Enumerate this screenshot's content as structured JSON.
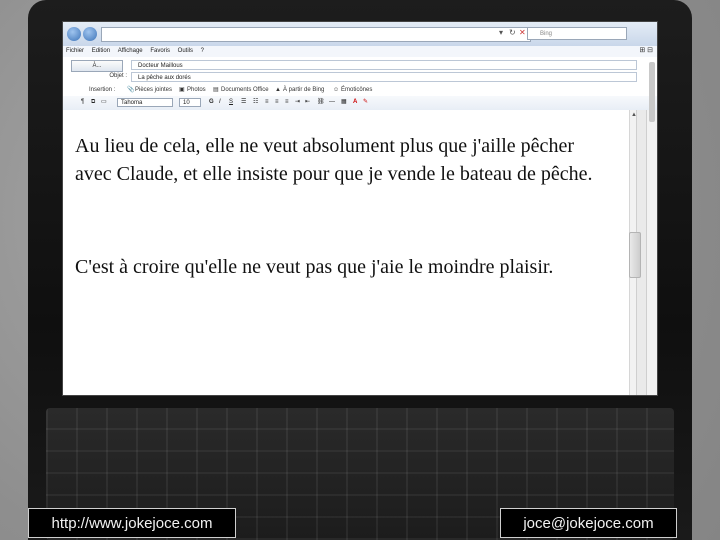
{
  "browser": {
    "search_engine": "Bing"
  },
  "menu": [
    "Fichier",
    "Edition",
    "Affichage",
    "Favoris",
    "Outils",
    "?"
  ],
  "email": {
    "to_button": "À...",
    "to_value": "Docteur Maillous",
    "subject_label": "Objet :",
    "subject_value": "La pêche aux dorés",
    "insert_label": "Insertion :",
    "insert_items": [
      "Pièces jointes",
      "Photos",
      "Documents Office",
      "À partir de Bing",
      "Émoticônes"
    ],
    "font_name": "Tahoma",
    "font_size": "10",
    "format_buttons": [
      "G",
      "I",
      "S"
    ]
  },
  "body": {
    "paragraph1": "Au lieu de cela, elle ne veut absolument plus que j'aille pêcher avec Claude, et elle insiste pour que je vende le bateau de pêche.",
    "paragraph2": "C'est à croire qu'elle ne veut pas que j'aie le moindre plaisir."
  },
  "footer": {
    "website": "http://www.jokejoce.com",
    "email": "joce@jokejoce.com"
  }
}
